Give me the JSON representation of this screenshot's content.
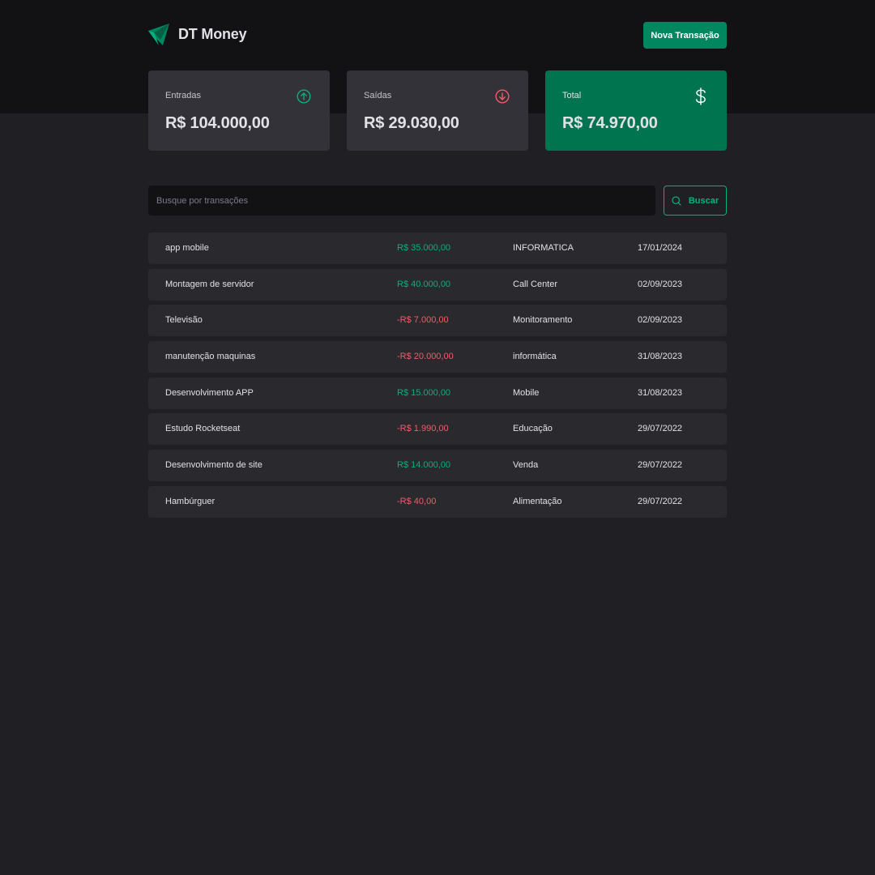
{
  "header": {
    "brand_name": "DT Money",
    "new_transaction_label": "Nova Transação"
  },
  "summary": {
    "income": {
      "label": "Entradas",
      "value": "R$ 104.000,00",
      "icon": "arrow-circle-up-icon",
      "icon_color": "#00b37e"
    },
    "outcome": {
      "label": "Saídas",
      "value": "R$ 29.030,00",
      "icon": "arrow-circle-down-icon",
      "icon_color": "#f75a68"
    },
    "total": {
      "label": "Total",
      "value": "R$ 74.970,00",
      "icon": "currency-dollar-icon",
      "card_color": "#00744f"
    }
  },
  "search": {
    "placeholder": "Busque por transações",
    "value": "",
    "button_label": "Buscar"
  },
  "colors": {
    "income": "#00b37e",
    "outcome": "#f75a68",
    "brand": "#00875f"
  },
  "transactions": [
    {
      "description": "app mobile",
      "price": "R$ 35.000,00",
      "type": "income",
      "category": "INFORMATICA",
      "date": "17/01/2024"
    },
    {
      "description": "Montagem de servidor",
      "price": "R$ 40.000,00",
      "type": "income",
      "category": "Call Center",
      "date": "02/09/2023"
    },
    {
      "description": "Televisão",
      "price": "-R$ 7.000,00",
      "type": "outcome",
      "category": "Monitoramento",
      "date": "02/09/2023"
    },
    {
      "description": "manutenção maquinas",
      "price": "-R$ 20.000,00",
      "type": "outcome",
      "category": "informática",
      "date": "31/08/2023"
    },
    {
      "description": "Desenvolvimento APP",
      "price": "R$ 15.000,00",
      "type": "income",
      "category": "Mobile",
      "date": "31/08/2023"
    },
    {
      "description": "Estudo Rocketseat",
      "price": "-R$ 1.990,00",
      "type": "outcome",
      "category": "Educação",
      "date": "29/07/2022"
    },
    {
      "description": "Desenvolvimento de site",
      "price": "R$ 14.000,00",
      "type": "income",
      "category": "Venda",
      "date": "29/07/2022"
    },
    {
      "description": "Hambúrguer",
      "price": "-R$ 40,00",
      "type": "outcome",
      "category": "Alimentação",
      "date": "29/07/2022"
    }
  ]
}
